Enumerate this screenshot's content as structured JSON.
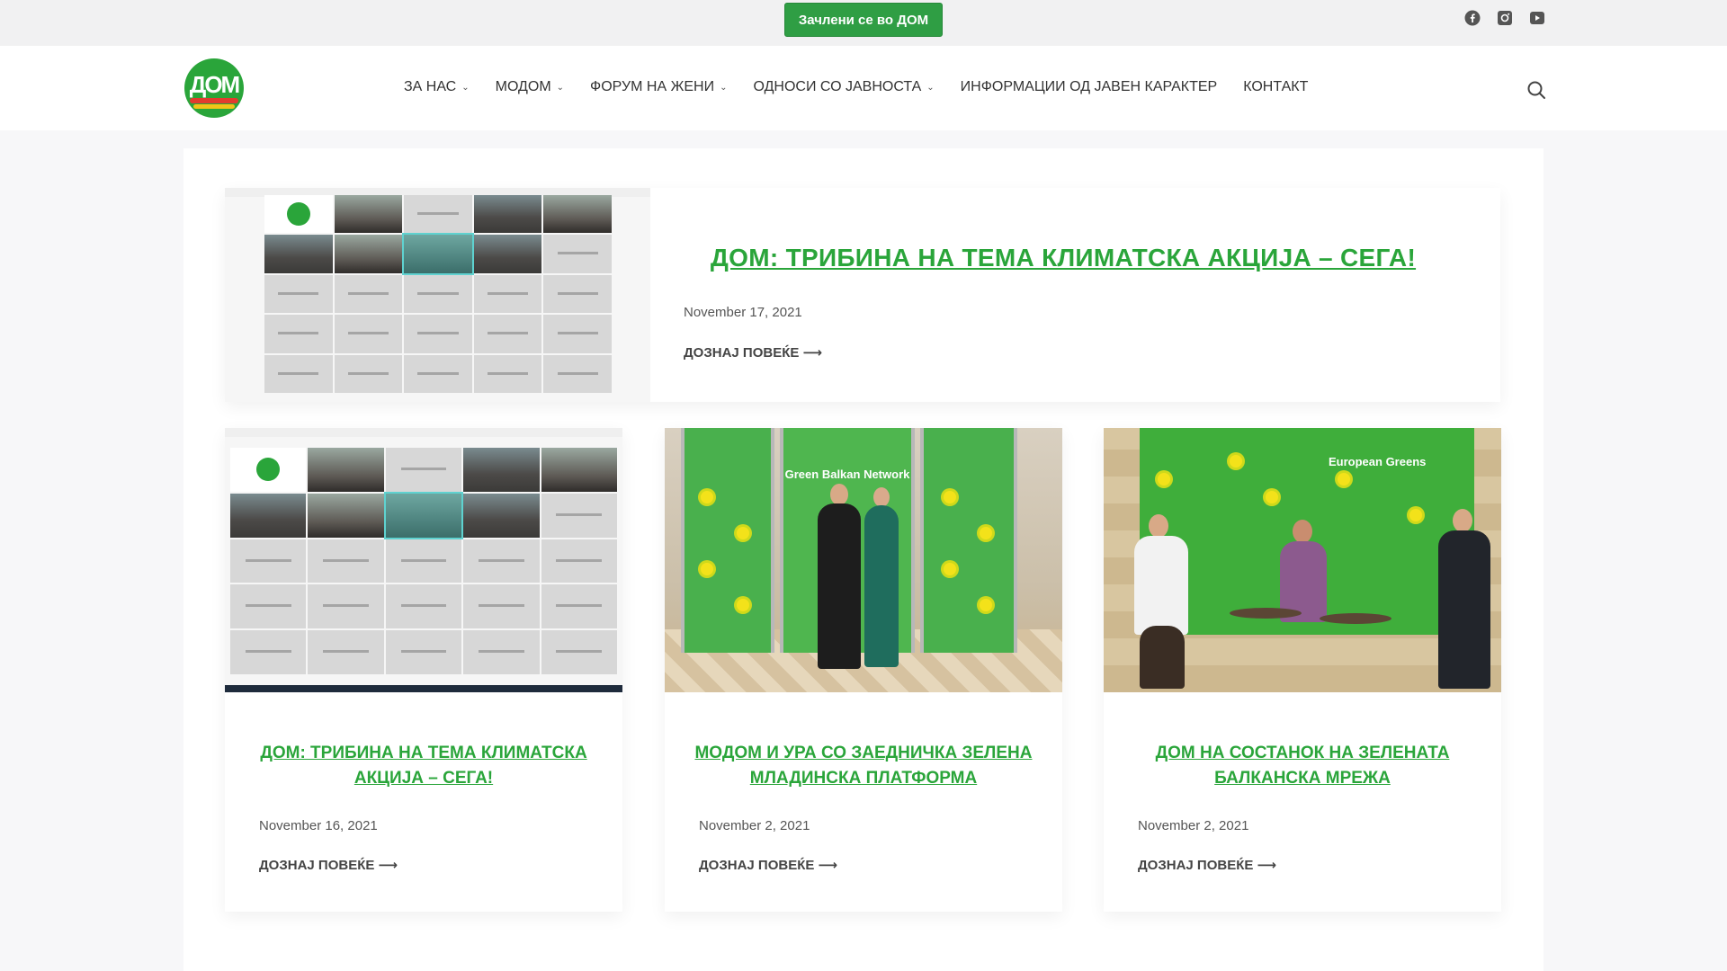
{
  "topbar": {
    "join_label": "Зачлени се во ДОМ",
    "social": [
      {
        "icon": "facebook-icon"
      },
      {
        "icon": "instagram-icon"
      },
      {
        "icon": "youtube-icon"
      }
    ]
  },
  "header": {
    "logo_text": "ДОМ",
    "nav": [
      {
        "label": "ЗА НАС",
        "dropdown": true
      },
      {
        "label": "МОДОМ",
        "dropdown": true
      },
      {
        "label": "ФОРУМ НА ЖЕНИ",
        "dropdown": true
      },
      {
        "label": "ОДНОСИ СО ЈАВНОСТА",
        "dropdown": true
      },
      {
        "label": "ИНФОРМАЦИИ ОД ЈАВЕН КАРАКТЕР",
        "dropdown": false
      },
      {
        "label": "КОНТАКТ",
        "dropdown": false
      }
    ],
    "search_icon": "search-icon"
  },
  "featured": {
    "title": "ДОМ: ТРИБИНА НА ТЕМА КЛИМАТСКА АКЦИЈА – СЕГА!",
    "date": "November 17, 2021",
    "more": "ДОЗНАЈ ПОВЕЌЕ ⟶"
  },
  "posts": [
    {
      "title": "ДОМ: ТРИБИНА НА ТЕМА КЛИМАТСКА АКЦИЈА – СЕГА!",
      "date": "November 16, 2021",
      "more": "ДОЗНАЈ ПОВЕЌЕ ⟶"
    },
    {
      "title": "МОДОМ И УРА СО ЗАЕДНИЧКА ЗЕЛЕНА МЛАДИНСКА ПЛАТФОРМА",
      "date": "November 2, 2021",
      "more": "ДОЗНАЈ ПОВЕЌЕ ⟶",
      "banner_text": "Green Balkan Network"
    },
    {
      "title": "ДОМ НА СОСТАНОК НА ЗЕЛЕНАТА БАЛКАНСКА МРЕЖА",
      "date": "November 2, 2021",
      "more": "ДОЗНАЈ ПОВЕЌЕ ⟶",
      "banner_text": "European Greens"
    }
  ],
  "colors": {
    "brand_green": "#2aa53a",
    "button_green": "#2f9e44",
    "logo_red": "#e23b2e",
    "logo_yellow": "#f2c318"
  }
}
